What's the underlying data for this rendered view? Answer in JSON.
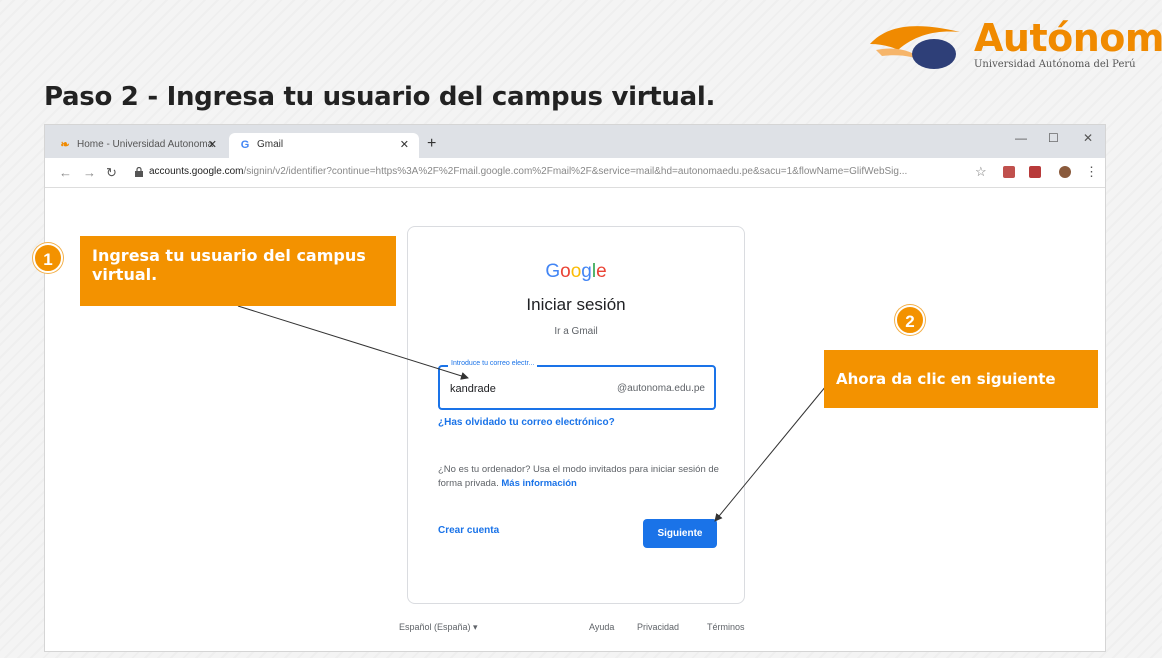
{
  "brand": {
    "name": "Autónoma",
    "subtitle": "Universidad Autónoma del Perú",
    "color": "#f08a00"
  },
  "step_title": "Paso 2 - Ingresa tu usuario del campus virtual.",
  "browser": {
    "tabs": [
      {
        "label": "Home - Universidad Autonoma",
        "icon": "autonoma-favicon-icon"
      },
      {
        "label": "Gmail",
        "icon": "google-g-icon"
      }
    ],
    "address": {
      "host": "accounts.google.com",
      "path": "/signin/v2/identifier?continue=https%3A%2F%2Fmail.google.com%2Fmail%2F&service=mail&hd=autonomaedu.pe&sacu=1&flowName=GlifWebSig..."
    }
  },
  "signin": {
    "logo": "Google",
    "title": "Iniciar sesión",
    "subtitle": "Ir a Gmail",
    "email_label": "Introduce tu correo electr...",
    "email_value": "kandrade",
    "email_suffix": "@autonoma.edu.pe",
    "forgot_link": "¿Has olvidado tu correo electrónico?",
    "guest_text": "¿No es tu ordenador? Usa el modo invitados para iniciar sesión de forma privada.",
    "more_info": "Más información",
    "create_account": "Crear cuenta",
    "next_button": "Siguiente"
  },
  "footer": {
    "language": "Español (España) ▾",
    "help": "Ayuda",
    "privacy": "Privacidad",
    "terms": "Términos"
  },
  "annotations": [
    {
      "number": "1",
      "text": "Ingresa tu usuario del campus virtual."
    },
    {
      "number": "2",
      "text": "Ahora da clic en siguiente"
    }
  ],
  "colors": {
    "accent": "#f39200",
    "google_blue": "#1a73e8"
  }
}
